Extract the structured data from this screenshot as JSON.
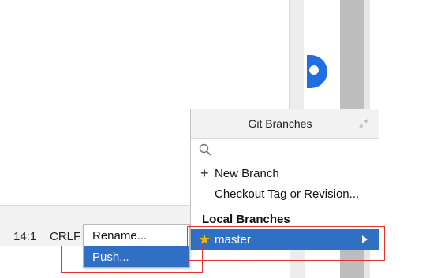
{
  "status_bar": {
    "position": "14:1",
    "line_ending": "CRLF"
  },
  "popup": {
    "title": "Git Branches",
    "search_placeholder": "",
    "actions": [
      {
        "label": "New Branch",
        "icon": "plus-icon"
      },
      {
        "label": "Checkout Tag or Revision..."
      }
    ],
    "section_header": "Local Branches",
    "branch": {
      "label": "master",
      "icon": "star-icon",
      "star_color": "#f4b400"
    }
  },
  "context_menu": {
    "items": [
      {
        "label": "Rename..."
      },
      {
        "label": "Push..."
      }
    ]
  },
  "colors": {
    "selection": "#2f6fc4",
    "annotation": "#e03232",
    "accent_circle": "#1f6ee5"
  }
}
